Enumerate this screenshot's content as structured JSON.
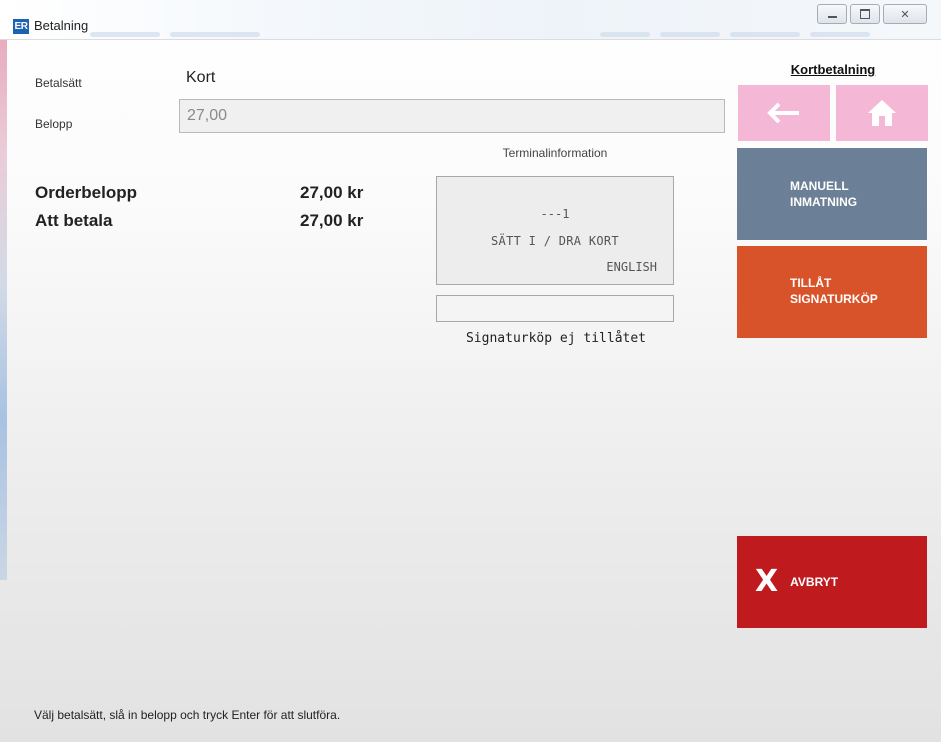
{
  "window": {
    "logo": "ER",
    "title": "Betalning"
  },
  "form": {
    "payment_method_label": "Betalsätt",
    "payment_method_value": "Kort",
    "amount_label": "Belopp",
    "amount_value": "27,00"
  },
  "summary": {
    "order_label": "Orderbelopp",
    "order_value": "27,00 kr",
    "to_pay_label": "Att betala",
    "to_pay_value": "27,00 kr"
  },
  "terminal": {
    "title": "Terminalinformation",
    "lines": [
      "---1",
      "SÄTT I / DRA KORT",
      "ENGLISH"
    ],
    "signature_status": "Signaturköp ej tillåtet"
  },
  "panel": {
    "title": "Kortbetalning",
    "back_icon": "arrow-left-icon",
    "home_icon": "home-icon",
    "manual_entry": [
      "MANUELL",
      "INMATNING"
    ],
    "allow_signature": [
      "TILLÅT",
      "SIGNATURKÖP"
    ],
    "cancel_label": "AVBRYT",
    "colors": {
      "nav": "#f4b8d6",
      "manual": "#6b7f96",
      "signature": "#d9532a",
      "cancel": "#bf1b1f"
    }
  },
  "hint": "Välj betalsätt, slå in belopp och tryck Enter för att slutföra."
}
